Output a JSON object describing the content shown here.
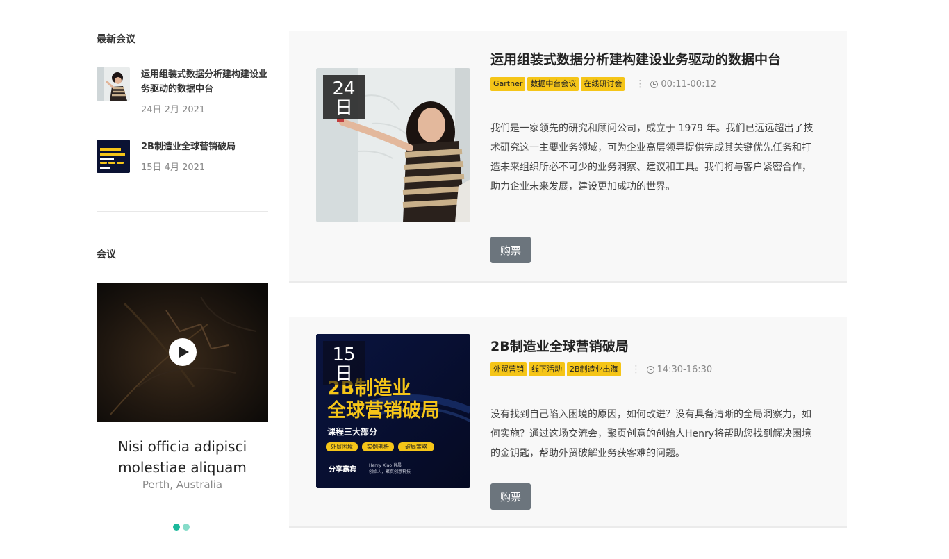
{
  "sidebar": {
    "recent_heading": "最新会议",
    "recent_items": [
      {
        "title": "运用组装式数据分析建构建设业务驱动的数据中台",
        "date": "24日 2月 2021"
      },
      {
        "title": "2B制造业全球营销破局",
        "date": "15日 4月 2021"
      }
    ],
    "conference_heading": "会议",
    "slider": {
      "title": "Nisi officia adipisci molestiae aliquam",
      "location": "Perth, Australia",
      "active_slide": 1,
      "slide_count": 2
    }
  },
  "events": [
    {
      "day": "24",
      "day_suffix": "日",
      "title": "运用组装式数据分析建构建设业务驱动的数据中台",
      "tags": [
        "Gartner",
        "数据中台会议",
        "在线研讨会"
      ],
      "time": "00:11-00:12",
      "description": "我们是一家领先的研究和顾问公司，成立于 1979 年。我们已远远超出了技术研究这一主要业务领域，可为企业高层领导提供完成其关键优先任务和打造未来组织所必不可少的业务洞察、建议和工具。我们将与客户紧密合作，助力企业未来发展，建设更加成功的世界。",
      "buy_label": "购票"
    },
    {
      "day": "15",
      "day_suffix": "日",
      "title": "2B制造业全球营销破局",
      "tags": [
        "外贸营销",
        "线下活动",
        "2B制造业出海"
      ],
      "time": "14:30-16:30",
      "description": "没有找到自己陷入困境的原因，如何改进？没有具备清晰的全局洞察力，如何实施？通过这场交流会，聚页创意的创始人Henry将帮助您找到解决困境的金钥匙，帮助外贸破解业务获客难的问题。",
      "buy_label": "购票",
      "poster": {
        "line1": "2B制造业",
        "line2": "全球营销破局",
        "subtitle": "课程三大部分",
        "pills": [
          "外贸困境",
          "实例剖析",
          "破局策略"
        ],
        "guest_label": "分享嘉宾",
        "guest_name": "Henry Xiao 肖晨",
        "guest_role": "创始人，聚页创意科技"
      }
    }
  ],
  "colors": {
    "tag": "#f5c518",
    "button": "#6c757d",
    "dot_active": "#1bb89b",
    "dot_inactive": "#86dcc9",
    "card_bg": "#f8f8f8"
  }
}
